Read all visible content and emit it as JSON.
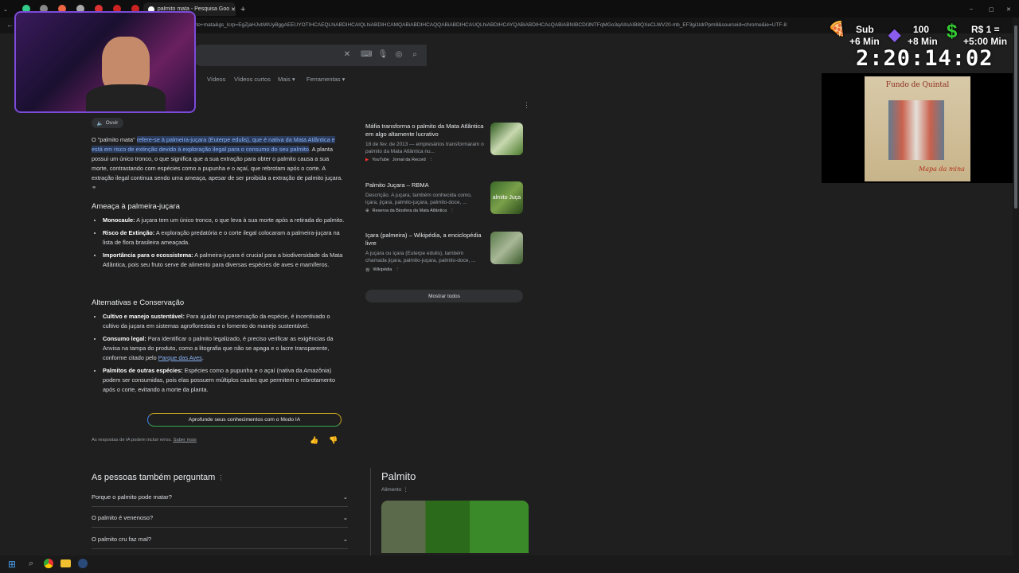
{
  "browser": {
    "tab_title": "palmito mata - Pesquisa Google",
    "url": "ito+mata&gs_lcrp=EgZjaHJvbWUyBggAEEUYOTIHCAEQLhiABDIHCAIQLhiABDIHCAMQABiABDIHCAQQABiABDIHCAUQLhiABDIHCAYQABiABDIHCAcQABiABNIBCDI3NTFqMGo3qAIIsAIB8QXeCLWV20-mb_EF3gi1ldrPpm8&sourceid=chrome&ie=UTF-8"
  },
  "nav": {
    "videos": "Vídeos",
    "short_videos": "Vídeos curtos",
    "more": "Mais",
    "tools": "Ferramentas"
  },
  "ai_overview": {
    "listen": "Ouvir",
    "intro_plain": "O \"palmito mata\" ",
    "intro_highlight": "refere-se à palmeira-juçara (Euterpe edulis), que é nativa da Mata Atlântica e está em risco de extinção devido à exploração ilegal para o consumo do seu palmito",
    "intro_rest": ". A planta possui um único tronco, o que significa que a sua extração para obter o palmito causa a sua morte, contrastando com espécies como a pupunha e o açaí, que rebrotam após o corte. A extração ilegal continua sendo uma ameaça, apesar de ser proibida a extração de palmito juçara.",
    "section1_title": "Ameaça à palmeira-juçara",
    "section1": [
      {
        "term": "Monocaule:",
        "text": " A juçara tem um único tronco, o que leva à sua morte após a retirada do palmito."
      },
      {
        "term": "Risco de Extinção:",
        "text": " A exploração predatória e o corte ilegal colocaram a palmeira-juçara na lista de flora brasileira ameaçada."
      },
      {
        "term": "Importância para o ecossistema:",
        "text": " A palmeira-juçara é crucial para a biodiversidade da Mata Atlântica, pois seu fruto serve de alimento para diversas espécies de aves e mamíferos."
      }
    ],
    "section2_title": "Alternativas e Conservação",
    "section2": [
      {
        "term": "Cultivo e manejo sustentável:",
        "text": " Para ajudar na preservação da espécie, é incentivado o cultivo da juçara em sistemas agroflorestais e o fomento do manejo sustentável."
      },
      {
        "term": "Consumo legal:",
        "text": " Para identificar o palmito legalizado, é preciso verificar as exigências da Anvisa na tampa do produto, como a litografia que não se apaga e o lacre transparente, conforme citado pelo ",
        "link": "Parque das Aves",
        "after": "."
      },
      {
        "term": "Palmitos de outras espécies:",
        "text": " Espécies como a pupunha e o açaí (nativa da Amazônia) podem ser consumidas, pois elas possuem múltiplos caules que permitem o rebrotamento após o corte, evitando a morte da planta."
      }
    ],
    "ai_mode_button": "Aprofunde seus conhecimentos com o Modo IA",
    "disclaimer": "As respostas de IA podem incluir erros.",
    "learn_more": "Saber mais"
  },
  "sources": [
    {
      "title": "Máfia transforma o palmito da Mata Atlântica em algo altamente lucrativo",
      "desc": "18 de fev. de 2013 — empresários transformaram o palmito da Mata Atlântica nu...",
      "site": "YouTube",
      "channel": "Jornal da Record"
    },
    {
      "title": "Palmito Juçara – RBMA",
      "desc": "Descrição. A juçara, também conhecida como, içara, jiçara, palmito-juçara, palmito-doce, ...",
      "site": "Reserva da Biosfera da Mata Atlântica",
      "thumb_text": "almito Juça"
    },
    {
      "title": "Içara (palmeira) – Wikipédia, a enciclopédia livre",
      "desc": "A juçara ou içara (Euterpe edulis), também chamada jiçara, palmito-juçara, palmito-doce, ...",
      "site": "Wikipédia"
    }
  ],
  "show_all": "Mostrar todos",
  "paa": {
    "title": "As pessoas também perguntam",
    "questions": [
      "Porque o palmito pode matar?",
      "O palmito é venenoso?",
      "O palmito cru faz mal?"
    ]
  },
  "knowledge_panel": {
    "title": "Palmito",
    "subtitle": "Alimento"
  },
  "overlay": {
    "sub_label": "Sub",
    "sub_time": "+6 Min",
    "hundred": "100",
    "hundred_time": "+8 Min",
    "money": "R$ 1 =",
    "money_time": "+5:00 Min",
    "timer": "2:20:14:02",
    "album_title": "Fundo de Quintal",
    "album_sub": "Mapa da mina"
  },
  "colors": {
    "accent_blue": "#8ab4f8",
    "bg": "#1f1f1f",
    "highlight": "#2a3a5a"
  }
}
